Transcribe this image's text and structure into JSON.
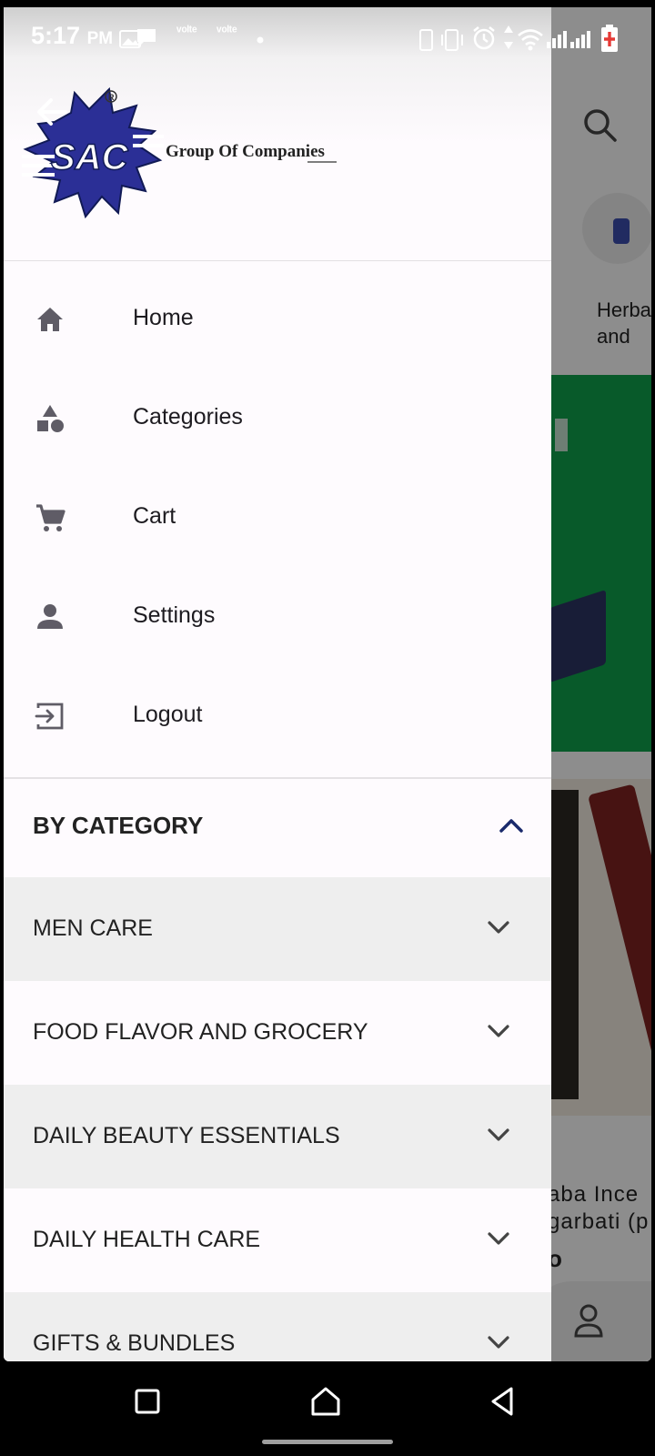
{
  "status_bar": {
    "time": "5:17",
    "ampm": "PM",
    "net_label_1": "ᵛᵒˡᵗᵉ",
    "net_label_2": "ᵛᵒˡᵗᵉ"
  },
  "drawer": {
    "brand_logo_text": "SAC",
    "brand_tagline": "Group Of Companies",
    "menu": [
      {
        "label": "Home",
        "icon": "home-icon"
      },
      {
        "label": "Categories",
        "icon": "categories-icon"
      },
      {
        "label": "Cart",
        "icon": "cart-icon"
      },
      {
        "label": "Settings",
        "icon": "person-icon"
      },
      {
        "label": "Logout",
        "icon": "logout-icon"
      }
    ],
    "category_section": {
      "title": "BY CATEGORY",
      "expanded": true,
      "items": [
        {
          "label": "MEN CARE"
        },
        {
          "label": "FOOD FLAVOR AND GROCERY"
        },
        {
          "label": "DAILY BEAUTY ESSENTIALS"
        },
        {
          "label": "DAILY HEALTH CARE"
        },
        {
          "label": "GIFTS & BUNDLES"
        }
      ]
    }
  },
  "background": {
    "category_label_line1": "Herba",
    "category_label_line2": "and",
    "product_name_line1": "aba  Ince",
    "product_name_line2": "garbati (p",
    "product_price": "o"
  },
  "colors": {
    "accent": "#1a2a6c",
    "drawer_bg": "#fefbfe",
    "shaded_row": "#eeeeee",
    "banner_green": "#0f9c49",
    "logo_blue": "#2b2f96"
  }
}
